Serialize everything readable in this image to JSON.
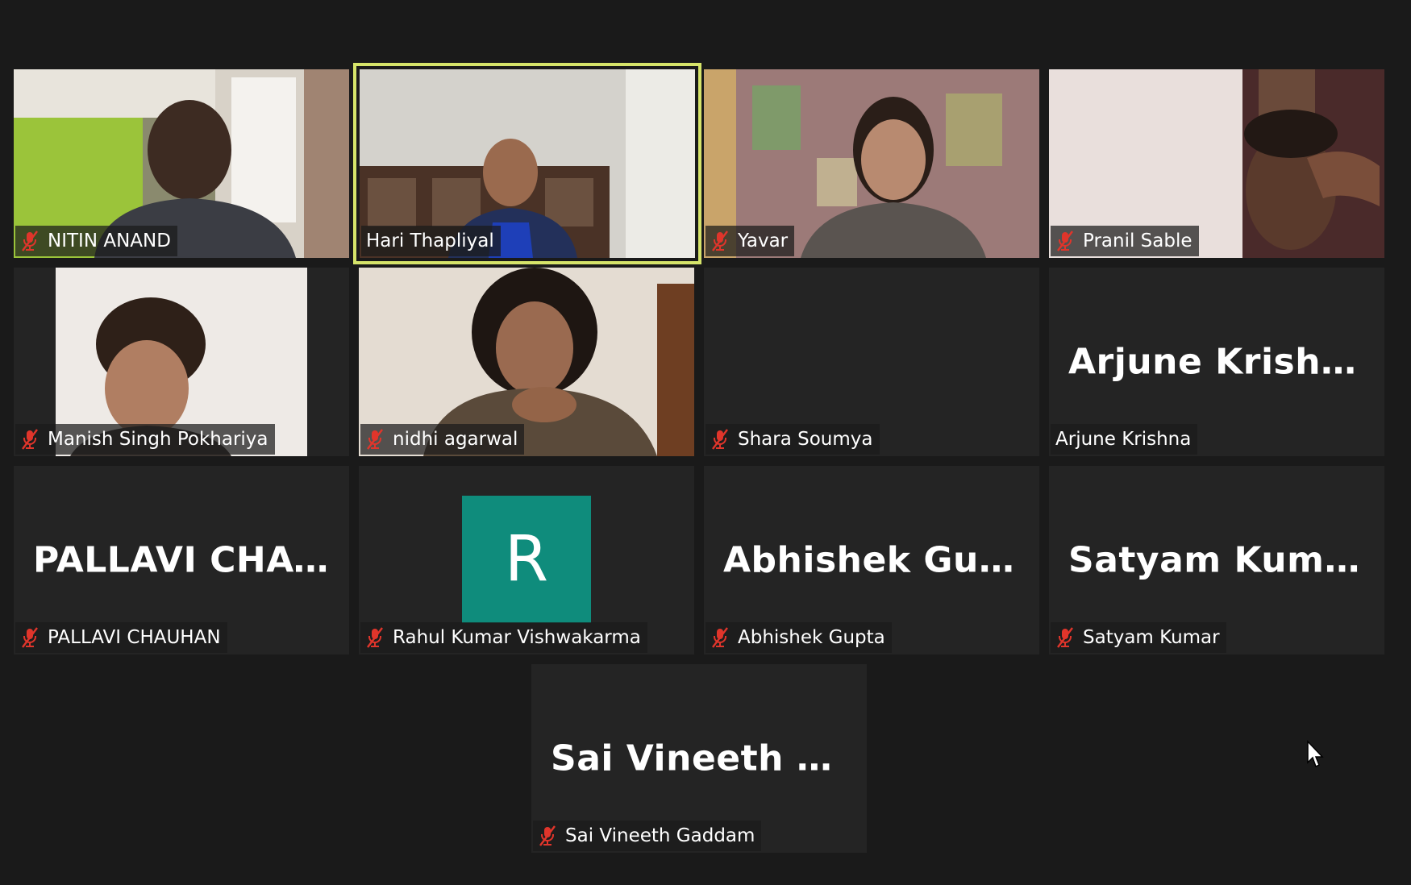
{
  "colors": {
    "background": "#1a1a1a",
    "tile": "#242424",
    "active_speaker_border": "#d6e46a",
    "muted_icon": "#e0352b",
    "avatar": "#0f8c7c"
  },
  "participants": [
    {
      "name": "NITIN ANAND",
      "muted": true,
      "video": true
    },
    {
      "name": "Hari Thapliyal",
      "muted": false,
      "video": true,
      "active_speaker": true
    },
    {
      "name": "Yavar",
      "muted": true,
      "video": true
    },
    {
      "name": "Pranil Sable",
      "muted": true,
      "video": true
    },
    {
      "name": "Manish Singh Pokhariya",
      "muted": true,
      "video": true
    },
    {
      "name": "nidhi agarwal",
      "muted": true,
      "video": true
    },
    {
      "name": "Shara Soumya",
      "muted": true,
      "video": true
    },
    {
      "name": "Arjune Krishna",
      "display": "Arjune Krishna",
      "muted": false,
      "video": false
    },
    {
      "name": "PALLAVI CHAUHAN",
      "display": "PALLAVI  CHAU...",
      "muted": true,
      "video": false
    },
    {
      "name": "Rahul Kumar Vishwakarma",
      "avatar_letter": "R",
      "muted": true,
      "video": false
    },
    {
      "name": "Abhishek Gupta",
      "display": "Abhishek Gupta",
      "muted": true,
      "video": false
    },
    {
      "name": "Satyam Kumar",
      "display": "Satyam Kumar",
      "muted": true,
      "video": false
    },
    {
      "name": "Sai Vineeth Gaddam",
      "display": "Sai  Vineeth  Gad...",
      "muted": true,
      "video": false
    }
  ]
}
